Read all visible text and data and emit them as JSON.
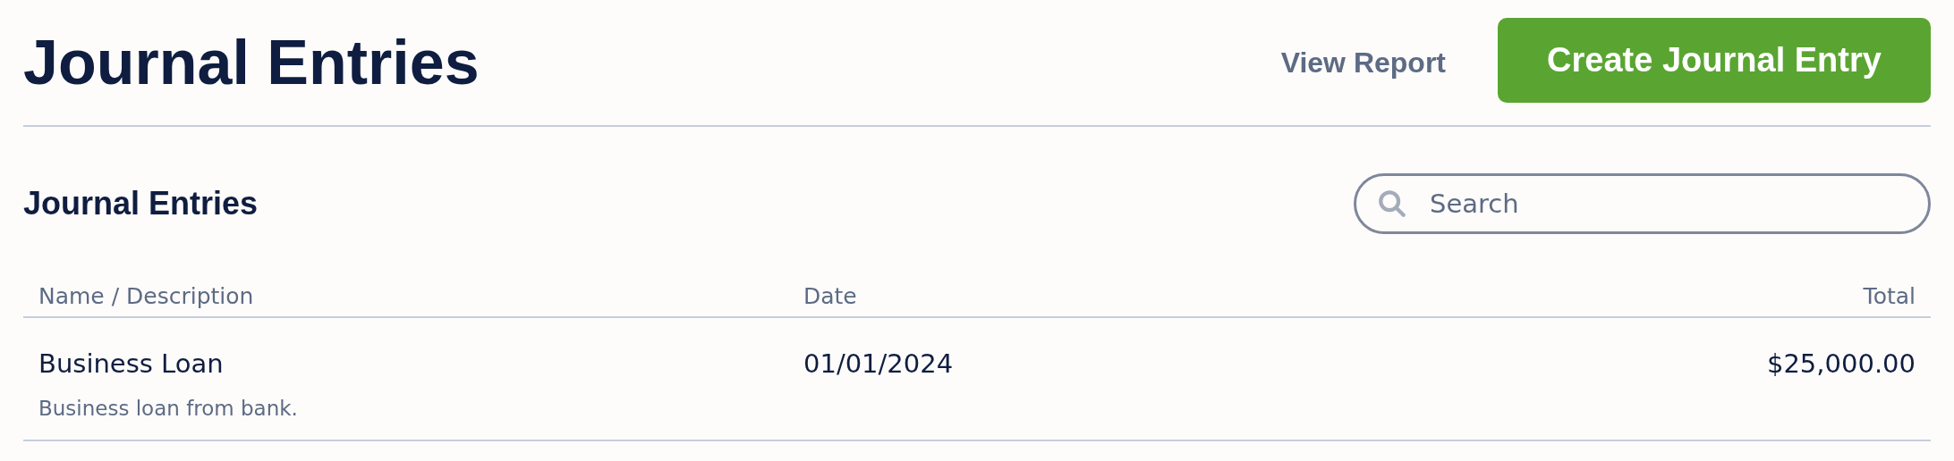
{
  "header": {
    "title": "Journal Entries",
    "link": "View Report",
    "primary_button": "Create Journal Entry"
  },
  "section": {
    "title": "Journal Entries",
    "search": {
      "placeholder": "Search"
    }
  },
  "table": {
    "columns": [
      "Name / Description",
      "Date",
      "Total"
    ],
    "rows": [
      {
        "name": "Business Loan",
        "description": "Business loan from bank.",
        "date": "01/01/2024",
        "total": "$25,000.00"
      }
    ]
  }
}
